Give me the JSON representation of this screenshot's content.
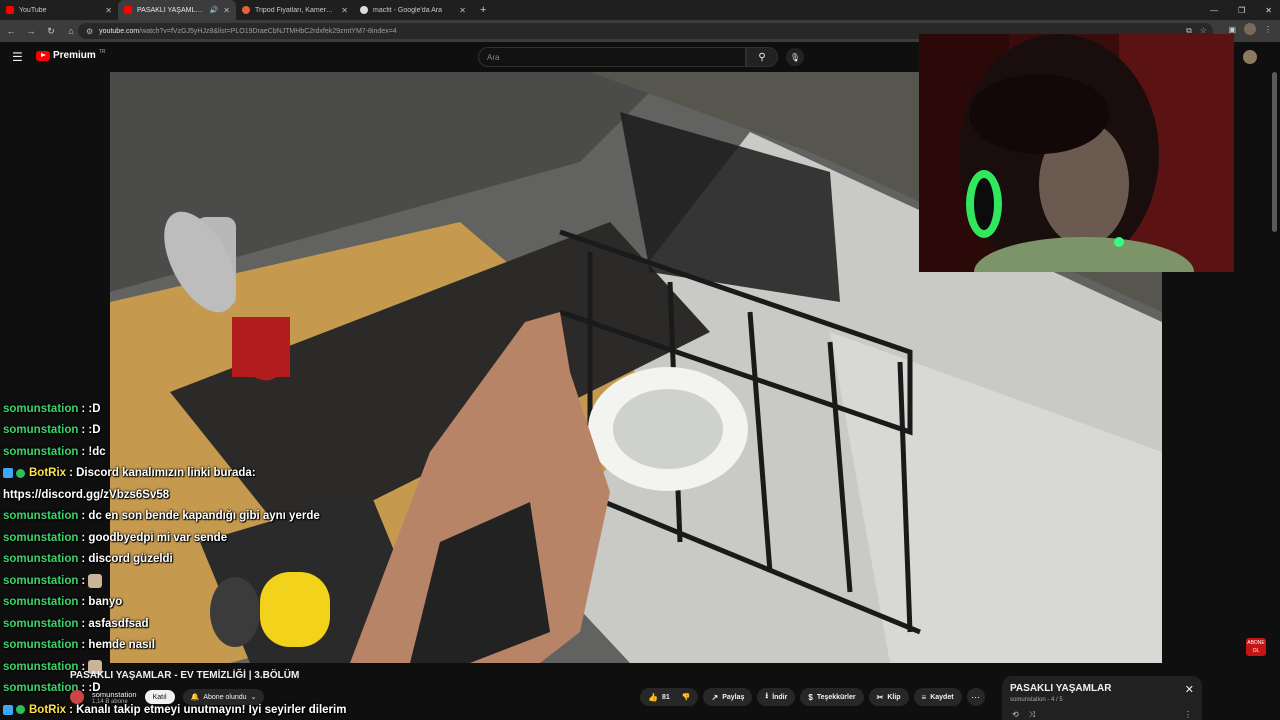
{
  "browser": {
    "tabs": [
      {
        "title": "YouTube",
        "fav": "#ff0000",
        "active": false
      },
      {
        "title": "PASAKLI YAŞAMLAR - EV TE",
        "fav": "#ff0000",
        "active": true
      },
      {
        "title": "Tripod Fiyatları, Kamera ve Tele",
        "fav": "#e8603c",
        "active": false
      },
      {
        "title": "macfit - Google'da Ara",
        "fav": "#dddddd",
        "active": false
      }
    ],
    "url_host": "youtube.com",
    "url_rest": "/watch?v=fVzGJ5yHJz8&list=PLO19DraeCbNJTMHbC2rdxfek29zmtYM7-8index=4"
  },
  "youtube": {
    "logo_text": "Premium",
    "logo_country": "TR",
    "search_placeholder": "Ara"
  },
  "chat": [
    {
      "user": "somunstation",
      "msg": ": :D",
      "type": "user"
    },
    {
      "user": "somunstation",
      "msg": ": :D",
      "type": "user"
    },
    {
      "user": "somunstation",
      "msg": ": !dc",
      "type": "user"
    },
    {
      "user": "BotRix",
      "msg": ": Discord kanalımızın linki burada:",
      "type": "bot"
    },
    {
      "user": "",
      "msg": "https://discord.gg/zVbzs6Sv58",
      "type": "cont"
    },
    {
      "user": "somunstation",
      "msg": ": dc en son bende kapandığı gibi aynı yerde",
      "type": "user"
    },
    {
      "user": "somunstation",
      "msg": ": goodbyedpi mi var sende",
      "type": "user"
    },
    {
      "user": "somunstation",
      "msg": ": discord güzeldi",
      "type": "user"
    },
    {
      "user": "somunstation",
      "msg": ":",
      "type": "user",
      "emote": true
    },
    {
      "user": "somunstation",
      "msg": ": banyo",
      "type": "user"
    },
    {
      "user": "somunstation",
      "msg": ": asfasdfsad",
      "type": "user"
    },
    {
      "user": "somunstation",
      "msg": ": hemde nasıl",
      "type": "user"
    },
    {
      "user": "somunstation",
      "msg": ":",
      "type": "user",
      "emote": true
    },
    {
      "user": "somunstation",
      "msg": ": :D",
      "type": "user"
    },
    {
      "user": "BotRix",
      "msg": ": Kanalı takip etmeyi unutmayın! İyi seyirler dilerim",
      "type": "bot"
    }
  ],
  "video": {
    "title": "PASAKLI YAŞAMLAR - EV TEMİZLİĞİ | 3.BÖLÜM",
    "channel": "somunstation",
    "subs": "1,14 B abone",
    "join": "Katıl",
    "subscribed": "Abone olundu",
    "likes": "81",
    "share": "Paylaş",
    "download": "İndir",
    "thanks": "Teşekkürler",
    "clip": "Klip",
    "save": "Kaydet",
    "sub_badge": "ABONE OL"
  },
  "playlist": {
    "title": "PASAKLI YAŞAMLAR",
    "meta": "somunstation - 4 / 5"
  }
}
